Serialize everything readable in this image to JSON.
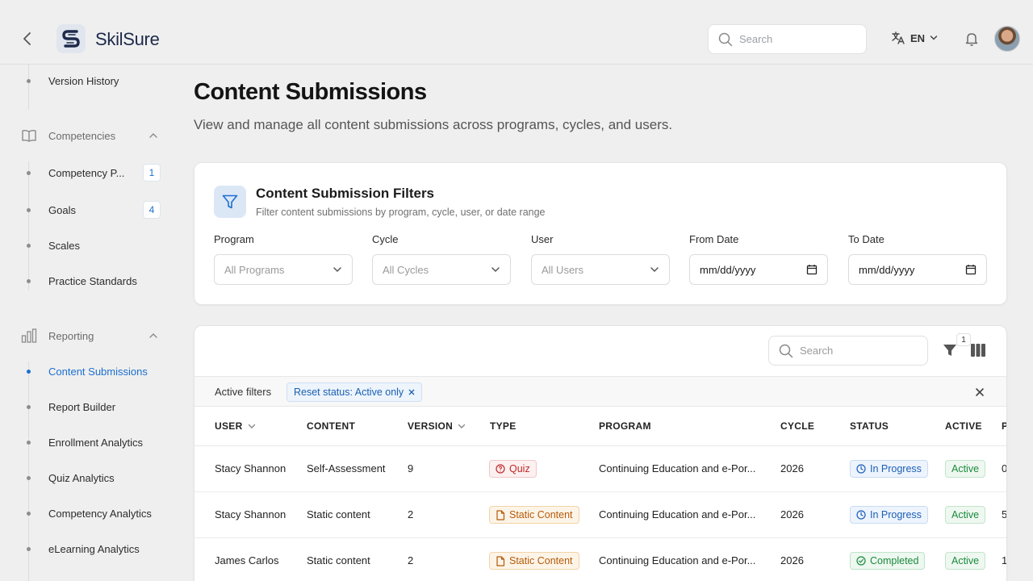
{
  "header": {
    "brand": "SkilSure",
    "search_placeholder": "Search",
    "language": "EN"
  },
  "sidebar": {
    "items": [
      {
        "label": "Version History"
      },
      {
        "label": "Competency P...",
        "badge": "1"
      },
      {
        "label": "Goals",
        "badge": "4"
      },
      {
        "label": "Scales"
      },
      {
        "label": "Practice Standards"
      },
      {
        "label": "Content Submissions",
        "active": true
      },
      {
        "label": "Report Builder"
      },
      {
        "label": "Enrollment Analytics"
      },
      {
        "label": "Quiz Analytics"
      },
      {
        "label": "Competency Analytics"
      },
      {
        "label": "eLearning Analytics"
      }
    ],
    "sections": [
      {
        "label": "Competencies"
      },
      {
        "label": "Reporting"
      }
    ]
  },
  "page": {
    "title": "Content Submissions",
    "subtitle": "View and manage all content submissions across programs, cycles, and users."
  },
  "filters": {
    "title": "Content Submission Filters",
    "subtitle": "Filter content submissions by program, cycle, user, or date range",
    "program": {
      "label": "Program",
      "placeholder": "All Programs"
    },
    "cycle": {
      "label": "Cycle",
      "placeholder": "All Cycles"
    },
    "user": {
      "label": "User",
      "placeholder": "All Users"
    },
    "from_date": {
      "label": "From Date",
      "placeholder": "mm/dd/yyyy"
    },
    "to_date": {
      "label": "To Date",
      "placeholder": "mm/dd/yyyy"
    }
  },
  "table": {
    "search_placeholder": "Search",
    "filter_count": "1",
    "active_filters_label": "Active filters",
    "active_chip": "Reset status: Active only",
    "columns": [
      "USER",
      "CONTENT",
      "VERSION",
      "TYPE",
      "PROGRAM",
      "CYCLE",
      "STATUS",
      "ACTIVE",
      "P"
    ],
    "rows": [
      {
        "user": "Stacy Shannon",
        "content": "Self-Assessment",
        "version": "9",
        "type": "Quiz",
        "program": "Continuing Education and e-Por...",
        "cycle": "2026",
        "status": "In Progress",
        "active": "Active",
        "extra": "0"
      },
      {
        "user": "Stacy Shannon",
        "content": "Static content",
        "version": "2",
        "type": "Static Content",
        "program": "Continuing Education and e-Por...",
        "cycle": "2026",
        "status": "In Progress",
        "active": "Active",
        "extra": "5"
      },
      {
        "user": "James Carlos",
        "content": "Static content",
        "version": "2",
        "type": "Static Content",
        "program": "Continuing Education and e-Por...",
        "cycle": "2026",
        "status": "Completed",
        "active": "Active",
        "extra": "1"
      }
    ]
  }
}
